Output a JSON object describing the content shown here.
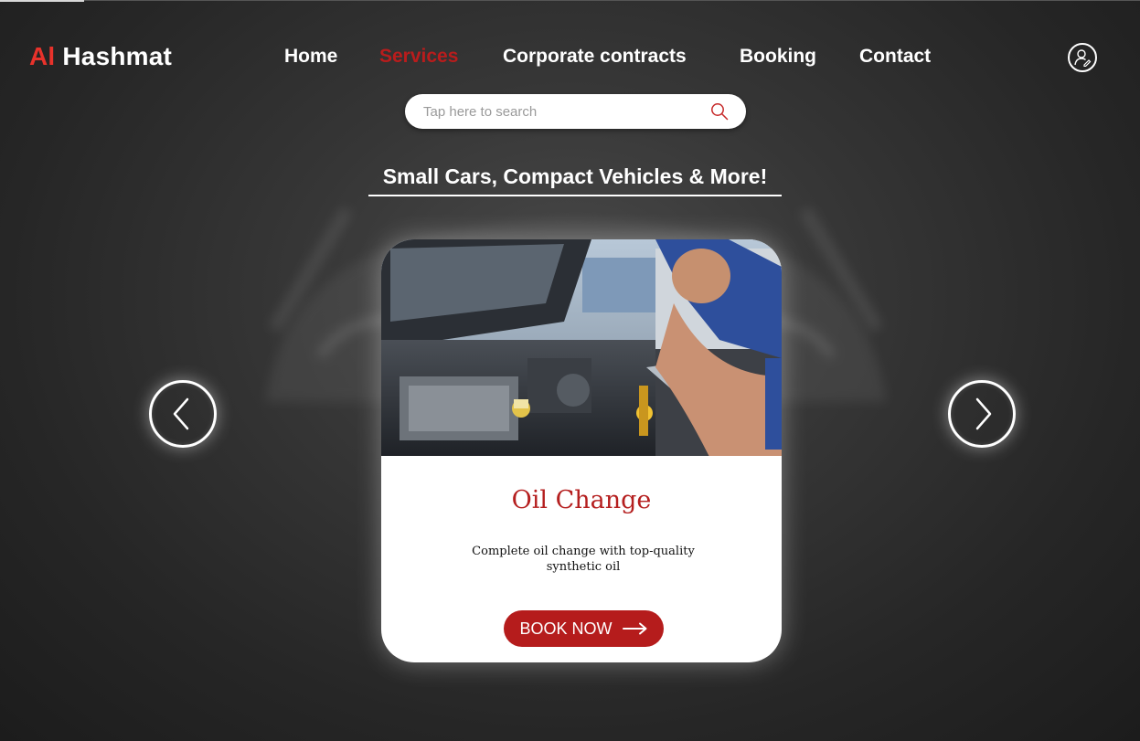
{
  "brand": {
    "logo_accent": "Al",
    "logo_rest": " Hashmat",
    "accent_color": "#e8322b"
  },
  "nav": {
    "items": [
      {
        "label": "Home"
      },
      {
        "label": "Services",
        "active": true
      },
      {
        "label": "Corporate contracts"
      },
      {
        "label": "Booking"
      },
      {
        "label": "Contact"
      }
    ],
    "active_color": "#b91c1c"
  },
  "header": {
    "profile_icon": "user-profile-icon"
  },
  "search": {
    "placeholder": "Tap here to search",
    "icon": "search-icon"
  },
  "section": {
    "heading": "Small Cars, Compact Vehicles & More!"
  },
  "carousel": {
    "prev_icon": "chevron-left-icon",
    "next_icon": "chevron-right-icon",
    "card": {
      "title": "Oil Change",
      "description": "Complete oil change with top-quality synthetic oil",
      "button_label": "BOOK NOW",
      "button_icon": "arrow-right-icon",
      "button_color": "#b51c1c"
    }
  }
}
